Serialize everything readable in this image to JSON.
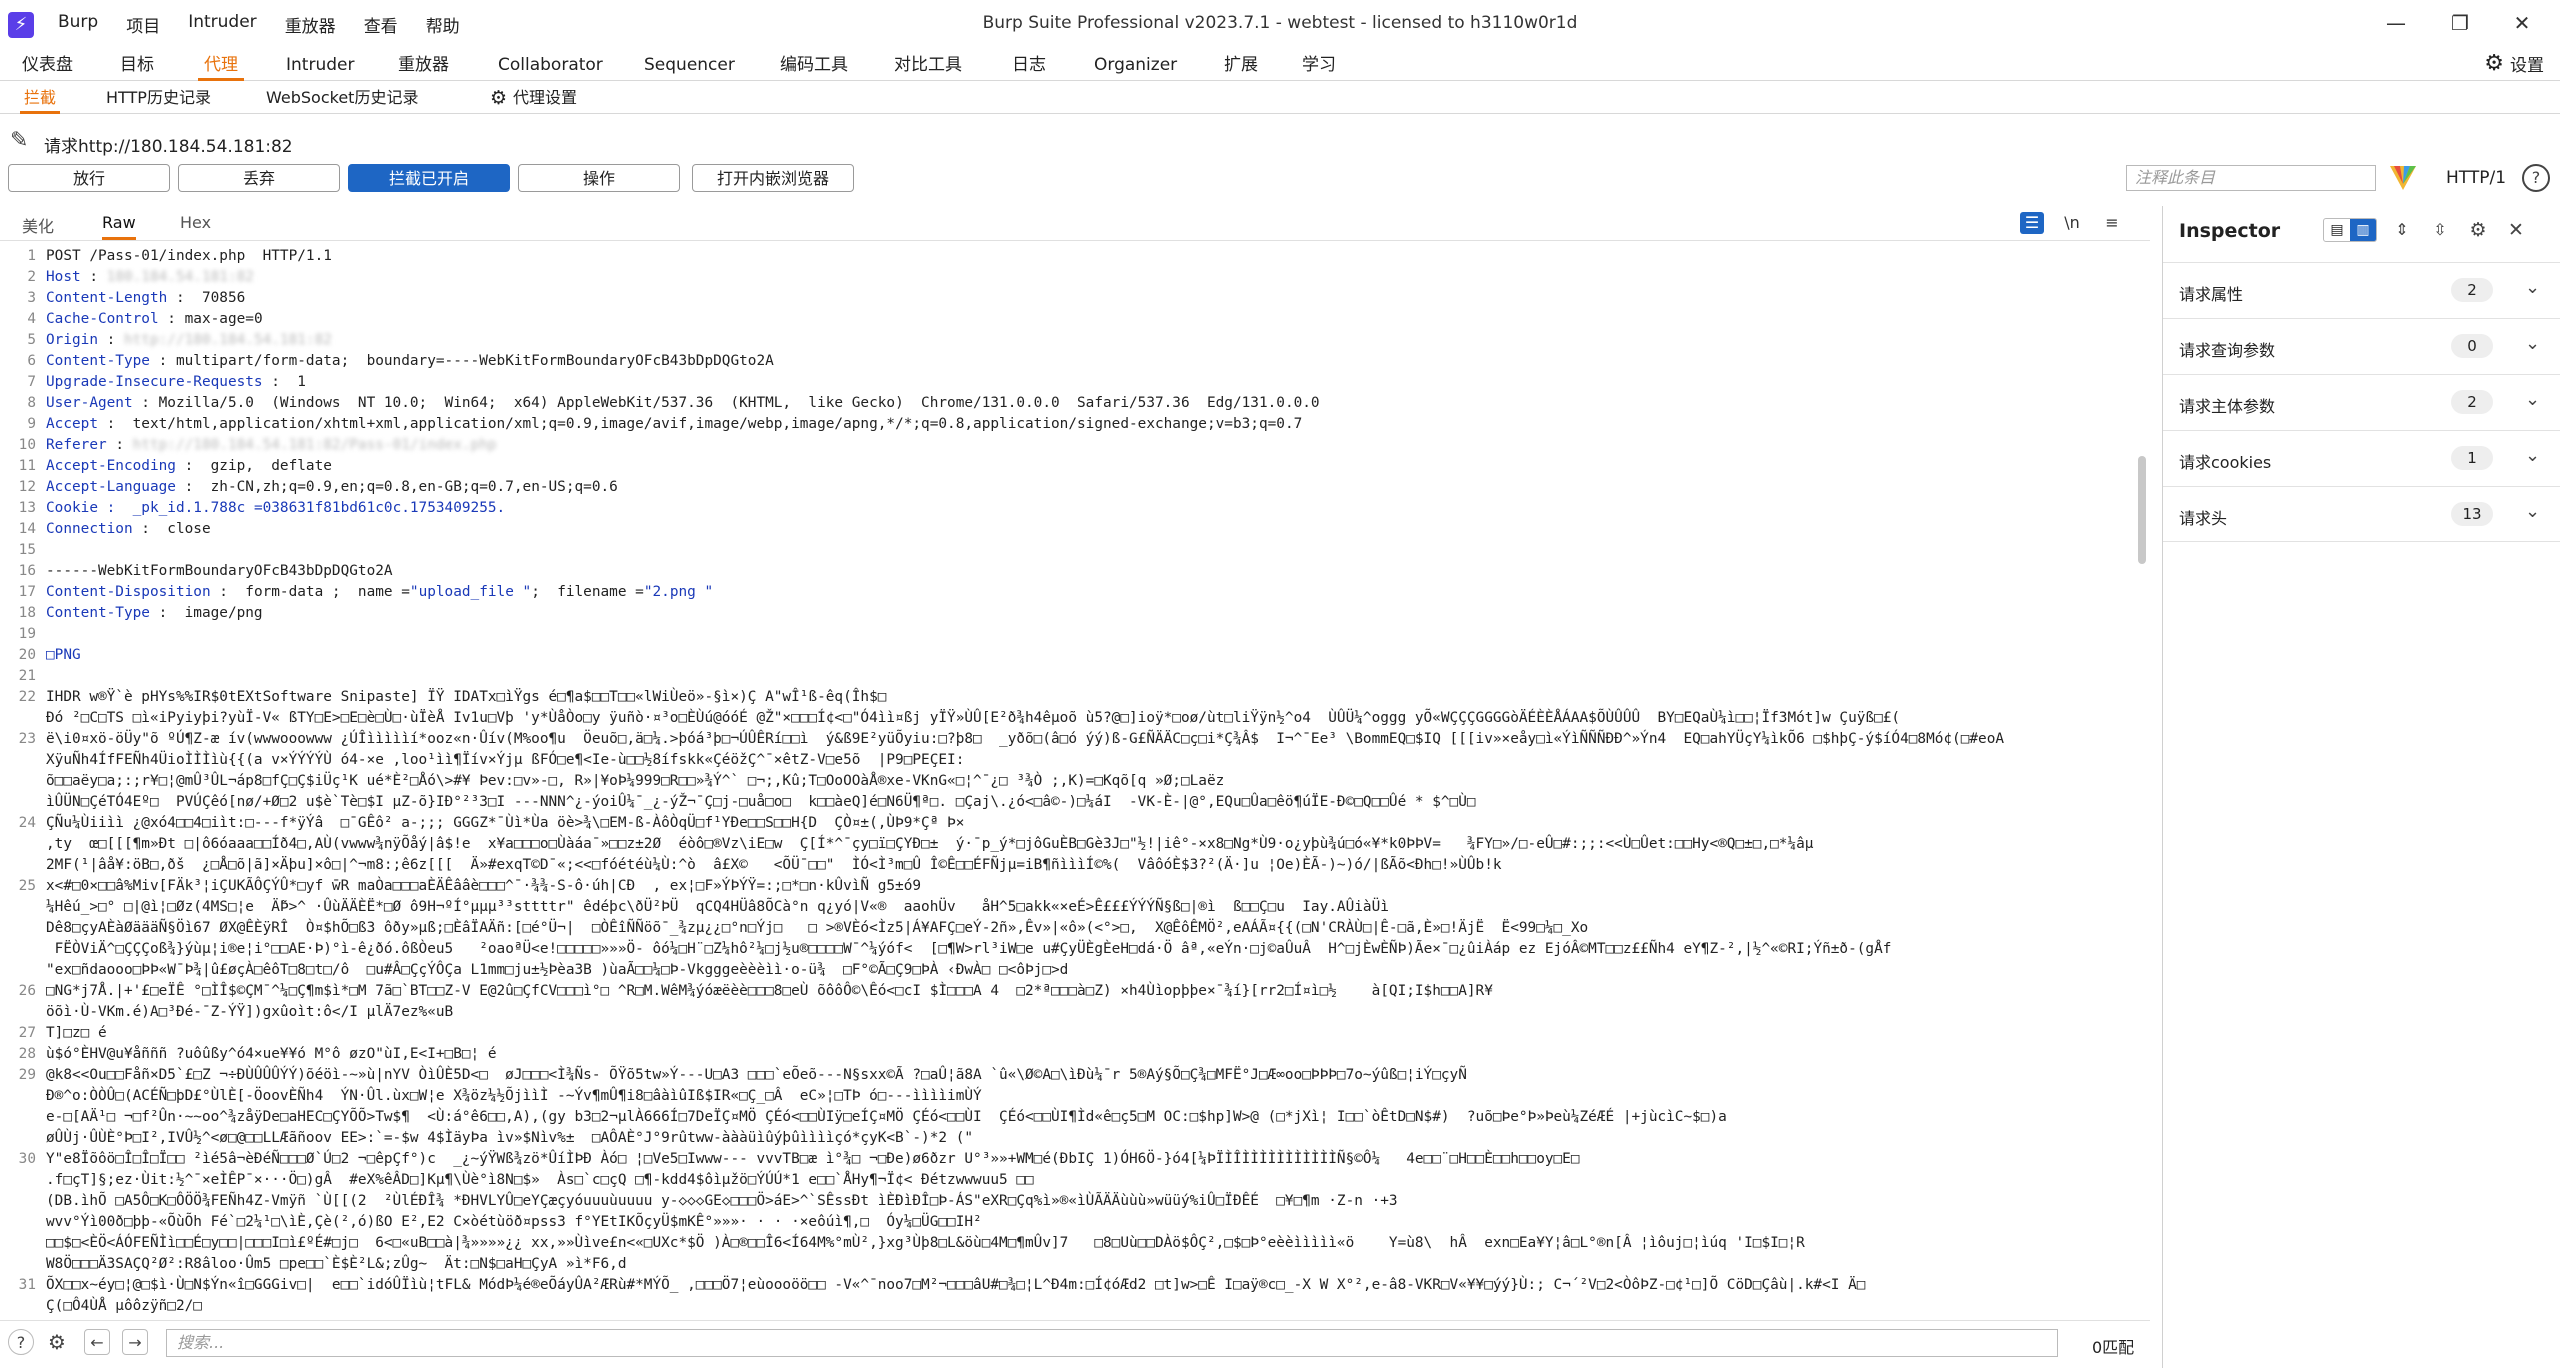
{
  "titlebar": {
    "logo_glyph": "⚡",
    "menu": [
      "Burp",
      "项目",
      "Intruder",
      "重放器",
      "查看",
      "帮助"
    ],
    "title": "Burp Suite Professional v2023.7.1 - webtest - licensed to h3110w0r1d",
    "min": "—",
    "max": "❐",
    "close": "✕"
  },
  "main_tabs": [
    "仪表盘",
    "目标",
    "代理",
    "Intruder",
    "重放器",
    "Collaborator",
    "Sequencer",
    "编码工具",
    "对比工具",
    "日志",
    "Organizer",
    "扩展",
    "学习"
  ],
  "active_main_tab": "代理",
  "settings_label": "设置",
  "sub_tabs": [
    "拦截",
    "HTTP历史记录",
    "WebSocket历史记录"
  ],
  "proxy_settings_label": "代理设置",
  "request_line": "请求http://180.184.54.181:82",
  "actions": {
    "forward": "放行",
    "drop": "丢弃",
    "intercept": "拦截已开启",
    "action": "操作",
    "browser": "打开内嵌浏览器",
    "annotation_placeholder": "注释此条目",
    "http_version": "HTTP/1",
    "help": "?"
  },
  "editor": {
    "tabs": [
      "美化",
      "Raw",
      "Hex"
    ],
    "active_tab": "Raw",
    "newline_toggle": "\\n",
    "menu_glyph": "≡"
  },
  "code_lines": [
    {
      "n": "1",
      "parts": [
        {
          "t": "POST /Pass-01/index.php  HTTP/1.1"
        }
      ]
    },
    {
      "n": "2",
      "parts": [
        {
          "t": "Host",
          "c": "k"
        },
        {
          "t": " : "
        },
        {
          "t": "180.184.54.181:82",
          "c": "blur"
        }
      ]
    },
    {
      "n": "3",
      "parts": [
        {
          "t": "Content-Length",
          "c": "k"
        },
        {
          "t": " :  70856"
        }
      ]
    },
    {
      "n": "4",
      "parts": [
        {
          "t": "Cache-Control",
          "c": "k"
        },
        {
          "t": " : max-age=0"
        }
      ]
    },
    {
      "n": "5",
      "parts": [
        {
          "t": "Origin",
          "c": "k"
        },
        {
          "t": " : "
        },
        {
          "t": "http://180.184.54.181:82",
          "c": "blur"
        }
      ]
    },
    {
      "n": "6",
      "parts": [
        {
          "t": "Content-Type",
          "c": "k"
        },
        {
          "t": " : multipart/form-data;  boundary=----WebKitFormBoundaryOFcB43bDpDQGto2A"
        }
      ]
    },
    {
      "n": "7",
      "parts": [
        {
          "t": "Upgrade-Insecure-Requests",
          "c": "k"
        },
        {
          "t": " :  1"
        }
      ]
    },
    {
      "n": "8",
      "parts": [
        {
          "t": "User-Agent",
          "c": "k"
        },
        {
          "t": " : Mozilla/5.0  (Windows  NT 10.0;  Win64;  x64) AppleWebKit/537.36  (KHTML,  like Gecko)  Chrome/131.0.0.0  Safari/537.36  Edg/131.0.0.0"
        }
      ]
    },
    {
      "n": "9",
      "parts": [
        {
          "t": "Accept",
          "c": "k"
        },
        {
          "t": " :  text/html,application/xhtml+xml,application/xml;q=0.9,image/avif,image/webp,image/apng,*/*;q=0.8,application/signed-exchange;v=b3;q=0.7"
        }
      ]
    },
    {
      "n": "10",
      "parts": [
        {
          "t": "Referer",
          "c": "k"
        },
        {
          "t": " : "
        },
        {
          "t": "http://180.184.54.181:82/Pass-01/index.php",
          "c": "blur"
        }
      ]
    },
    {
      "n": "11",
      "parts": [
        {
          "t": "Accept-Encoding",
          "c": "k"
        },
        {
          "t": " :  gzip,  deflate"
        }
      ]
    },
    {
      "n": "12",
      "parts": [
        {
          "t": "Accept-Language",
          "c": "k"
        },
        {
          "t": " :  zh-CN,zh;q=0.9,en;q=0.8,en-GB;q=0.7,en-US;q=0.6"
        }
      ]
    },
    {
      "n": "13",
      "parts": [
        {
          "t": "Cookie",
          "c": "k"
        },
        {
          "t": " :  _pk_id.1.788c",
          "c": "k"
        },
        {
          "t": " =038631f81bd61c0c.1753409255.",
          "c": "s"
        }
      ]
    },
    {
      "n": "14",
      "parts": [
        {
          "t": "Connection",
          "c": "k"
        },
        {
          "t": " :  close"
        }
      ]
    },
    {
      "n": "15",
      "parts": [
        {
          "t": ""
        }
      ]
    },
    {
      "n": "16",
      "parts": [
        {
          "t": "------WebKitFormBoundaryOFcB43bDpDQGto2A"
        }
      ]
    },
    {
      "n": "17",
      "parts": [
        {
          "t": "Content-Disposition",
          "c": "k"
        },
        {
          "t": " :  form-data ;  name ="
        },
        {
          "t": "\"upload_file \"",
          "c": "s"
        },
        {
          "t": ";  filename ="
        },
        {
          "t": "\"2.png \"",
          "c": "s"
        }
      ]
    },
    {
      "n": "18",
      "parts": [
        {
          "t": "Content-Type",
          "c": "k"
        },
        {
          "t": " :  image/png"
        }
      ]
    },
    {
      "n": "19",
      "parts": [
        {
          "t": ""
        }
      ]
    },
    {
      "n": "20",
      "parts": [
        {
          "t": "□PNG",
          "c": "k"
        }
      ]
    },
    {
      "n": "21",
      "parts": [
        {
          "t": ""
        }
      ]
    },
    {
      "n": "22",
      "tall": true,
      "parts": [
        {
          "t": "IHDR w®Ÿ`è pHYs%%IR$0tEXtSoftware Snipaste] ÏŸ IDATx□ìŸgs é□¶a$□□T□□«lWiÙeö»-§ì×)Ç A\"wÎ¹ß-êq(Îh$□\nÐó ²□C□TS □ì«iPyiyþi?yùÏ-V« ßTY□E>□E□è□Ù□·ùÏèÅ Iv1u□Vþ 'y*ÙåÒo□y ÿuñò·¤³o□ÈÙú@óóÉ @Ž\"×□□□Í¢<□\"Ó4ìì¤ßj yÏŸ»ÙÛ[E²ð¾h4êµoõ ù5?@□]ioÿ*□oø/ùt□liŸÿn½^o4  ÙÛÜ¼^oggg yÕ«WÇÇÇGGGGòÄÉÈÈÅÁAA$ÕÙÛÛÛ  BY□EQaÙ¼ì□□¦Ïf3Mót]w Çuÿß□£("
        }
      ]
    },
    {
      "n": "23",
      "tall": true,
      "parts": [
        {
          "t": "ë\\i0¤xö-öÜy\"õ ºÚ¶Z-æ ív(wwwooowww ¿ÚÎìììììí*ooz«n·Ûív(M%oo¶u  Öeuõ□,ä□¼.>þóá³þ□¬ÚÛÊRí□□ì  ý&ß9E²yüÕyiu:□?þ8□  _yðõ□(â□ó ýý)ß-G£ÑÄÄC□ç□i*Ç¾Â$  I¬^¯Ee³ \\BommEQ□$IQ [[[iv»×eåy□ì«ÝìÑÑÑÐÐ^»Ýn4  EQ□ahYÜçY¼ìkÕ6 □$hþÇ-ý$íÓ4□8Mó¢(□#eoA XÿuÑh4ÍfFEÑh4ÜioÌÌÌìù{{(a v×ÝÝÝÝÙ ó4-×e ,loo¹ìì¶Ïív×Ýjµ ßFÓ□e¶<Ie-ù□□½8ífskk«ÇéöžÇ^¯×êtZ-V□e5õ  |P9□PEÇEI:\nõ□□aëy□a;:;r¥□¦@mÛ³ÛL¬áp8□fÇ□Ç$iÜç¹K ué*È²□Åó\\>#¥ Þev:□v»-□, R»|¥oÞ¼999□R□□»¾Ý^` □¬;,Kû;T□ΟoΟΟàÅ®xe-VKnG«□¦^¯¿□ ³¾Ò ;,K)=□Kqõ[q »Ø;□Laëz\nìÛÜN□ÇéTÓ4Eº□  PVÚÇêó[nø/+Ø□2 u$è`Tè□$I µZ-õ}IÐ°²³3□I ---NNN^¿-ýoiÛ¼¯_¿-ýŽ¬¯Ç□j-□uå□o□  k□□àeQ]é□N6Ü¶ª□. □Çaj\\.¿ó<□â©-)□¼áI  -VK-È-|@°,EQu□Ûa□êö¶úÏE-Ð©□Q□□Ûé * $^□Ù□"
        }
      ]
    },
    {
      "n": "24",
      "tall": true,
      "parts": [
        {
          "t": "ÇÑu¼Ùiiìì ¿@xó4□□4□iìt:□---f*ÿÝâ  □¯GÊô² a-;;; GGGZ*¯Ùì*Ùa öè>¾\\□EM-ß-ÀôÒqÜ□f¹YÐe□□S□□H{D  ÇÒ¤±(,ÙÞ9*Çª Þ×\n,ty  œ□[[[¶m»Ðt □|ô6óaaa□□Íð4□,AÙ(vwww¾nÿÕåý|â$!e  x¥a□□□o□Ùàáa¯»□□z±2Ø  éòô□®Vz\\iE□w  Ç[Í*^¯çy□ï□ÇYÐ□±  ý·¯p_ý*□jôGuÈB□Gè3J□\"½!|iê°-×x8□Ng*Ù9·o¿yþù¾ú□ó«¥*k0ÞÞV=   ¾FY□»/□-eÛ□#:;;:<<Ù□Ûet:□□Hy<®Q□±□,□*¼âµ\n2MF(¹|âå¥:öB□,ðš  ¿□Å□õ|ã]×Äþu]×ô□|^¬m8:;ê6z[[[  Ä»#exqT©D¯«;<<□fóétéù¼Ù:^ò  â£X©   <ÕÜ¯□□\"  ÌÓ<Ì³m□Û Î©Ê□□ÉFÑjµ=iB¶ñìììÍ©%(  VâôóÈ$3?²(Ä·]u ¦Oe)ÈÃ-)~)ó/|ßÃõ<Ðh□!»ÙÛb!k"
        }
      ]
    },
    {
      "n": "25",
      "tall": true,
      "parts": [
        {
          "t": "x<#□0×□□â%Miv[FÄk³¦iÇUKÃÔÇÝÛ*□yf w̄R maÒa□□□aÈÄÊââè□□□^¯·¾¾-S-ô·úh|CÐ  , ex¦□F»ÝÞÝŸ=:;□*□n·kÛvìÑ g5±ó9\n¼Hêú_>□° □|@ì¦□Øz(4MS□¦e  Ä̃Þ>^ ·ÛùÄÄÈË*□Ø ô9H¬ºÍ°µµµ³³sttttr\" êdéþc\\ðÜ²ÞÜ  qCQ4HÜâ8ÕCà°n q¿yó|V«®  aaohÜv   åH^5□akk«×eÉ>Ê£££ÝÝÝÑ§ß□|®ì  ß□□Ç□u  Iay.AÛiàÜì\nDê8□çyAÈàØäääÑ§Öì67 ØX@ÊÈÿRÎ  Ò¤$hÕ□ß3 ôðy»µß;□ÈâÏAÄñ:[□é°Ü¬|  □ÒÊîÑÑöõ¯_¾zµ¿¿□°n□Ýj□   □ >®VÈó<Ìz5|Á¥AFÇ□eÝ-2ñ»,Êv»|«ô»(<°>□,  X@ÊôÊMÖ²,eAÁÃ¤{{(□N'CRÀÙ□|Ê-□ã,È»□!ÄjË  Ë<99□¼□_Xo\n FËÒViÄ^□ÇÇÇoß¾}ýùµ¦i®e¦i°□□AE·Þ)°ì-ê¿ðó.ôßÒeu5   ²oaoªÜ<e!□□□□□»»»Ö- ôó¼□H¨□Z¼hô²¼□j½u®□□□□W¯^¼ýóf<  [□¶W>rl³iW□e u#ÇyÜÈgÈeH□dá·Ö âª,«eÝn·□j©aÛuÂ  H^□jÈwÈÑÞ)Ãe×¯□¿ûiÀáp ez EjóÂ©MT□□z££Ñh4 eY¶Z-²,|½^«©RI;Ýñ±ð-(gÅf\n\"ex□ñdaooo□ÞÞ«W¯Þ¾|û£øçÀ□êôT□8□t□/ô  □u#Â□ÇçÝÔÇa L1mm□ju±½Þèa3B )ùaÃ□□¼□Þ-Vkgggeèèèìì·o-ü¾  □F°©Ã□Ç9□ÞÀ ‹ÐwÀ□ □<ôÞj□>d"
        }
      ]
    },
    {
      "n": "26",
      "parts": [
        {
          "t": "□NG*j7Å.|+'£□eÏÊ °□ÌÎ$©ÇM¯^¼□Ç¶m$ì*□M 7ã□`BT□□Z-V E@2û□ÇfCV□□□ì°□ ^R□M.WêM¾ýóæëèè□□□8□eÙ õôôÔ©\\Êó<□cI $Ì□□□A 4  □2*ª□□□à□Z) ×h4Ùìopþþe×¯¾í}[rr2□Í¤ì□½    à[QI;I$h□□A]R¥"
        }
      ]
    },
    {
      "n": "",
      "parts": [
        {
          "t": "öõì·Ù-VKm.é)A□³Ðé-¯Z-ÝŸ])gxûoìt:ô</I µlÄ7ez%«uB"
        }
      ]
    },
    {
      "n": "27",
      "parts": [
        {
          "t": "T]□z□ é"
        }
      ]
    },
    {
      "n": "28",
      "parts": [
        {
          "t": "ù$ó°ÈHV@u¥åñññ ?uôûßy^ó4×ue¥¥ó M°ô øzO\"ùI,E<I+□B□¦ é"
        }
      ]
    },
    {
      "n": "29",
      "tall": true,
      "parts": [
        {
          "t": "@k8<<Ou□□Fåñ×D5`£□Z ¬÷ÐÙÛÛÛÝÝ)õéöì-~»ù|nYV ÒìÛÈ5D<□  øJ□□□<Ì¾Ñs- ÕŸõ5tw»Ý---U□A3 □□□`eÕeõ---N§sxx©Ã ?□aÛ¦ã8A `û«\\Ø©A□\\ìÐù¼¯r 5®Aý§Õ□Ç¾□MFË°J□Æ∞oo□ÞÞÞ□7o~ýûß□¦iÝ□çyÑ\nÐ®^o:ÒÒÛ□(ACÉÑ□þD£°ÙlÈ[-ÖoovÈÑh4  ÝN·Ûl.ùx□W¦e X¾öz¼½ÕjììÌ -~Ýv¶mÛ¶i8□âàìûIß$IR«□Ç_□Â  eC»¦□TÞ ó□---ììììimÙÝ\ne-□[AÄ¹□ ¬□f²Ûn·~~oo^¾zåÿDe□aHEC□ÇYÕÕ>Tw$¶  <Ù:á°ê6□□,A),(gy b3□2¬µlÀ666Í□7DeÏÇ¤MÖ ÇÉó<□□ÙIÿ□eÍÇ¤MÖ ÇÉó<□□ÙI  ÇÉó<□□ÙI¶Ìd«ê□ç5□M OC:□$hp]W>@ (□*jXì¦ I□□`òÊtD□N$#)  ?uõ□Þe°Þ»Þeù¼ZéÆÉ |+jùcìC~$□)a\nøÛÙj·ÛÙÈ°Þ□I²,IVÛ½^<ø□@□□LLÆãñoov EE>:`=-$w 4$ÌäyÞa ìv»$Nìv%±  □AÔAÈ°J°9rûtww-àààüìûýþûììììçó*çyK<B`-)*2 (\""
        }
      ]
    },
    {
      "n": "30",
      "tall": true,
      "parts": [
        {
          "t": "Y\"e8Ïõôö□Î□Î□Ï□□ ²ìé5â¬èÐéÑ□□□Ø`Ú□2 ¬□êpÇf°)c  _¿~ýŸWß¾zö*ÛíÌÞÐ Àó□ ¦□Ve5□Iwww--- vvvTB□æ ì°¾□ ¬□Ðe)ø6ðzr U°³»»+WM□é(ÐbIÇ 1)ÓH6Ö-}ó4[¼ÞÏÌÎÌÌÌÌÌÌÌÌÌÌÌÑ§©Ô¼   4e□□¨□H□□È□□h□□oy□E□\n.f□çT]§;ez·Ùit:½^¯×eÌÊP¯×···Ö□)gÂ  #eX%êÂD□]Kµ¶\\Ùè°ì8N□$»  Às□`c□çQ □¶-kdd4$ôìµžö□ÝÚÚ*1 e□□`ÅHy¶¬Ï¢< Ðétzwwwuu5 □□\n(DB.ìhÕ □A5Ô□K□ÔÖÖ¾FEÑh4Z-Vmÿñ `Ù[[(2  ²ÙlÉÐÎ¾ *ÐHVLYÛ□eYÇæçyóuuuùuuuu y-◇◇◇GE◇□□□Ö>áE>^`SÊssÐt ìÈÐìÐÎ□Þ-ÁS\"eXR□Çq%ì»®«ìÙÃÄÄùùù»wüüý%iÛ□ÏÐÊÉ  □¥□¶m ·Z-n ·+3\nwvv°Ýì00ð□þþ-«ÕùÕh Fé`□2¼¹□\\ìÈ,Çè(²,ó)ßO E²,E2 C×òétùöð¤pss3 f°YEtIKÕçyÜ$mKÊ°»»»· · · ·×eôúì¶,□  Óy¼□ÜG□□IH²\n□□$□<ÈÖ<ÁÓFEÑÌì□□É□y□□|□□□I□ì£ºÉ#□j□  6<□«uB□□à|¾»»»»¿¿ xx,»»Ùìve£n<«□UXc*$Ö )À□®□□Î6<Í64M%°mÙ²,}xg³Ùþ8□L&öù□4M□¶mÛv]7   □8□Uù□□DÀö$ÔÇ²,□$□Þ°eèèììììì«ö    Y=ù8\\  hÂ  exn□Ea¥Y¦â□L°®n[Â ¦ìôuj□¦ìúq 'I□$I□¦R\nW8Ö□□□Ä3SAÇQ²Ø²:R8âloo·Ûm5 □pe□□`È$È²L&;zÛg~  Ät:□N$□aH□ÇyA »ì*F6,d"
        }
      ]
    },
    {
      "n": "31",
      "tall": true,
      "parts": [
        {
          "t": "ÕX□□x~éy□¦@□$ì·Ù□N$Ýn«î□GGGiv□|  e□□`idóÛÏìù¦tFL& MódÞ¼é®eÕáyÛA²ÆRù#*MÝÕ_ ,□□□Ö7¦eùoooöö□□ -V«^¯noo7□M²¬□□□âU#□¾□¦L^Ð4m:□Í¢óÆd2 □t]w>□Ê I□aÿ®c□_-X W X°²,e-â8-VKR□V«¥¥□ýý}Ù:; C¬´²V□2<ÒôÞZ-□¢¹□]Õ CöD□Çâù|.k#<I Ä□\nÇ(□Ô4ÙÅ µôôzÿñ□2/□"
        }
      ]
    }
  ],
  "bottom": {
    "help": "?",
    "gear": "⚙",
    "prev": "←",
    "next": "→",
    "search_placeholder": "搜索...",
    "match_count": "0匹配"
  },
  "inspector": {
    "title": "Inspector",
    "rows": [
      {
        "label": "请求属性",
        "count": "2"
      },
      {
        "label": "请求查询参数",
        "count": "0"
      },
      {
        "label": "请求主体参数",
        "count": "2"
      },
      {
        "label": "请求cookies",
        "count": "1"
      },
      {
        "label": "请求头",
        "count": "13"
      }
    ]
  },
  "colors": {
    "accent": "#e8720c",
    "primary": "#1e66c4",
    "header_key": "#1a39b8"
  }
}
